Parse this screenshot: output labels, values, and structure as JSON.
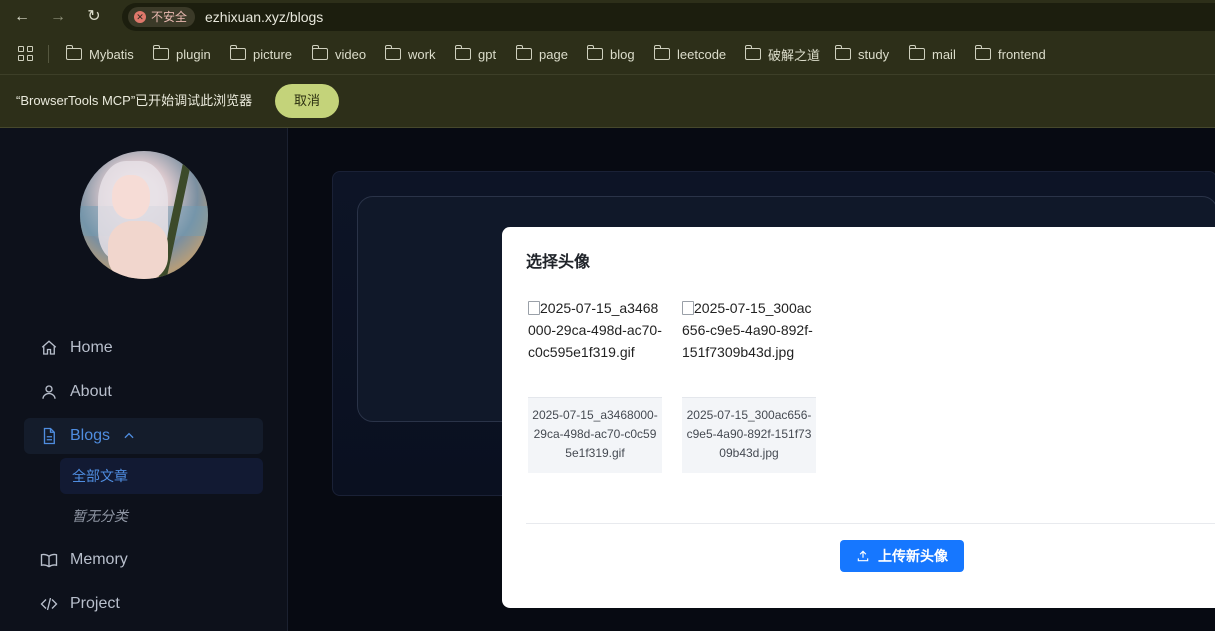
{
  "browser": {
    "security_label": "不安全",
    "url": "ezhixuan.xyz/blogs",
    "bookmarks": [
      "Mybatis",
      "plugin",
      "picture",
      "video",
      "work",
      "gpt",
      "page",
      "blog",
      "leetcode",
      "破解之道",
      "study",
      "mail",
      "frontend"
    ],
    "debug_message": "“BrowserTools MCP”已开始调试此浏览器",
    "cancel_label": "取消"
  },
  "sidebar": {
    "items": [
      {
        "label": "Home",
        "icon": "home-icon"
      },
      {
        "label": "About",
        "icon": "user-icon"
      },
      {
        "label": "Blogs",
        "icon": "document-icon"
      },
      {
        "label": "Memory",
        "icon": "book-icon"
      },
      {
        "label": "Project",
        "icon": "code-icon"
      }
    ],
    "blog_subitems": [
      "全部文章",
      "暂无分类"
    ]
  },
  "modal": {
    "title": "选择头像",
    "images": [
      {
        "alt": "2025-07-15_a3468000-29ca-498d-ac70-c0c595e1f319.gif",
        "name": "2025-07-15_a3468000-29ca-498d-ac70-c0c595e1f319.gif"
      },
      {
        "alt": "2025-07-15_300ac656-c9e5-4a90-892f-151f7309b43d.jpg",
        "name": "2025-07-15_300ac656-c9e5-4a90-892f-151f7309b43d.jpg"
      }
    ],
    "upload_label": "上传新头像"
  },
  "colors": {
    "browser_chrome": "#2d2f19",
    "accent": "#1677ff",
    "active_menu": "#4f8de0",
    "cancel_button": "#c4d37a"
  }
}
